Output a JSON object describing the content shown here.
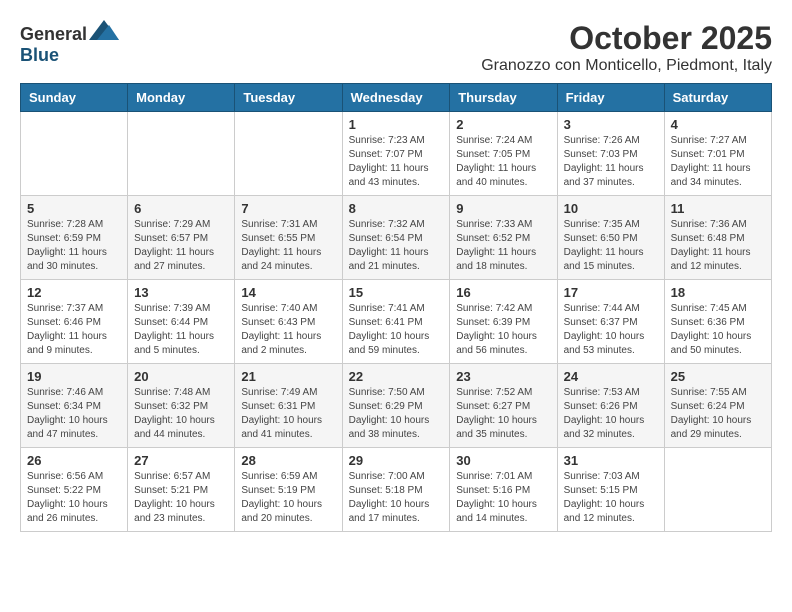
{
  "header": {
    "logo_general": "General",
    "logo_blue": "Blue",
    "month": "October 2025",
    "location": "Granozzo con Monticello, Piedmont, Italy"
  },
  "days_of_week": [
    "Sunday",
    "Monday",
    "Tuesday",
    "Wednesday",
    "Thursday",
    "Friday",
    "Saturday"
  ],
  "weeks": [
    [
      {
        "day": "",
        "sunrise": "",
        "sunset": "",
        "daylight": ""
      },
      {
        "day": "",
        "sunrise": "",
        "sunset": "",
        "daylight": ""
      },
      {
        "day": "",
        "sunrise": "",
        "sunset": "",
        "daylight": ""
      },
      {
        "day": "1",
        "sunrise": "Sunrise: 7:23 AM",
        "sunset": "Sunset: 7:07 PM",
        "daylight": "Daylight: 11 hours and 43 minutes."
      },
      {
        "day": "2",
        "sunrise": "Sunrise: 7:24 AM",
        "sunset": "Sunset: 7:05 PM",
        "daylight": "Daylight: 11 hours and 40 minutes."
      },
      {
        "day": "3",
        "sunrise": "Sunrise: 7:26 AM",
        "sunset": "Sunset: 7:03 PM",
        "daylight": "Daylight: 11 hours and 37 minutes."
      },
      {
        "day": "4",
        "sunrise": "Sunrise: 7:27 AM",
        "sunset": "Sunset: 7:01 PM",
        "daylight": "Daylight: 11 hours and 34 minutes."
      }
    ],
    [
      {
        "day": "5",
        "sunrise": "Sunrise: 7:28 AM",
        "sunset": "Sunset: 6:59 PM",
        "daylight": "Daylight: 11 hours and 30 minutes."
      },
      {
        "day": "6",
        "sunrise": "Sunrise: 7:29 AM",
        "sunset": "Sunset: 6:57 PM",
        "daylight": "Daylight: 11 hours and 27 minutes."
      },
      {
        "day": "7",
        "sunrise": "Sunrise: 7:31 AM",
        "sunset": "Sunset: 6:55 PM",
        "daylight": "Daylight: 11 hours and 24 minutes."
      },
      {
        "day": "8",
        "sunrise": "Sunrise: 7:32 AM",
        "sunset": "Sunset: 6:54 PM",
        "daylight": "Daylight: 11 hours and 21 minutes."
      },
      {
        "day": "9",
        "sunrise": "Sunrise: 7:33 AM",
        "sunset": "Sunset: 6:52 PM",
        "daylight": "Daylight: 11 hours and 18 minutes."
      },
      {
        "day": "10",
        "sunrise": "Sunrise: 7:35 AM",
        "sunset": "Sunset: 6:50 PM",
        "daylight": "Daylight: 11 hours and 15 minutes."
      },
      {
        "day": "11",
        "sunrise": "Sunrise: 7:36 AM",
        "sunset": "Sunset: 6:48 PM",
        "daylight": "Daylight: 11 hours and 12 minutes."
      }
    ],
    [
      {
        "day": "12",
        "sunrise": "Sunrise: 7:37 AM",
        "sunset": "Sunset: 6:46 PM",
        "daylight": "Daylight: 11 hours and 9 minutes."
      },
      {
        "day": "13",
        "sunrise": "Sunrise: 7:39 AM",
        "sunset": "Sunset: 6:44 PM",
        "daylight": "Daylight: 11 hours and 5 minutes."
      },
      {
        "day": "14",
        "sunrise": "Sunrise: 7:40 AM",
        "sunset": "Sunset: 6:43 PM",
        "daylight": "Daylight: 11 hours and 2 minutes."
      },
      {
        "day": "15",
        "sunrise": "Sunrise: 7:41 AM",
        "sunset": "Sunset: 6:41 PM",
        "daylight": "Daylight: 10 hours and 59 minutes."
      },
      {
        "day": "16",
        "sunrise": "Sunrise: 7:42 AM",
        "sunset": "Sunset: 6:39 PM",
        "daylight": "Daylight: 10 hours and 56 minutes."
      },
      {
        "day": "17",
        "sunrise": "Sunrise: 7:44 AM",
        "sunset": "Sunset: 6:37 PM",
        "daylight": "Daylight: 10 hours and 53 minutes."
      },
      {
        "day": "18",
        "sunrise": "Sunrise: 7:45 AM",
        "sunset": "Sunset: 6:36 PM",
        "daylight": "Daylight: 10 hours and 50 minutes."
      }
    ],
    [
      {
        "day": "19",
        "sunrise": "Sunrise: 7:46 AM",
        "sunset": "Sunset: 6:34 PM",
        "daylight": "Daylight: 10 hours and 47 minutes."
      },
      {
        "day": "20",
        "sunrise": "Sunrise: 7:48 AM",
        "sunset": "Sunset: 6:32 PM",
        "daylight": "Daylight: 10 hours and 44 minutes."
      },
      {
        "day": "21",
        "sunrise": "Sunrise: 7:49 AM",
        "sunset": "Sunset: 6:31 PM",
        "daylight": "Daylight: 10 hours and 41 minutes."
      },
      {
        "day": "22",
        "sunrise": "Sunrise: 7:50 AM",
        "sunset": "Sunset: 6:29 PM",
        "daylight": "Daylight: 10 hours and 38 minutes."
      },
      {
        "day": "23",
        "sunrise": "Sunrise: 7:52 AM",
        "sunset": "Sunset: 6:27 PM",
        "daylight": "Daylight: 10 hours and 35 minutes."
      },
      {
        "day": "24",
        "sunrise": "Sunrise: 7:53 AM",
        "sunset": "Sunset: 6:26 PM",
        "daylight": "Daylight: 10 hours and 32 minutes."
      },
      {
        "day": "25",
        "sunrise": "Sunrise: 7:55 AM",
        "sunset": "Sunset: 6:24 PM",
        "daylight": "Daylight: 10 hours and 29 minutes."
      }
    ],
    [
      {
        "day": "26",
        "sunrise": "Sunrise: 6:56 AM",
        "sunset": "Sunset: 5:22 PM",
        "daylight": "Daylight: 10 hours and 26 minutes."
      },
      {
        "day": "27",
        "sunrise": "Sunrise: 6:57 AM",
        "sunset": "Sunset: 5:21 PM",
        "daylight": "Daylight: 10 hours and 23 minutes."
      },
      {
        "day": "28",
        "sunrise": "Sunrise: 6:59 AM",
        "sunset": "Sunset: 5:19 PM",
        "daylight": "Daylight: 10 hours and 20 minutes."
      },
      {
        "day": "29",
        "sunrise": "Sunrise: 7:00 AM",
        "sunset": "Sunset: 5:18 PM",
        "daylight": "Daylight: 10 hours and 17 minutes."
      },
      {
        "day": "30",
        "sunrise": "Sunrise: 7:01 AM",
        "sunset": "Sunset: 5:16 PM",
        "daylight": "Daylight: 10 hours and 14 minutes."
      },
      {
        "day": "31",
        "sunrise": "Sunrise: 7:03 AM",
        "sunset": "Sunset: 5:15 PM",
        "daylight": "Daylight: 10 hours and 12 minutes."
      },
      {
        "day": "",
        "sunrise": "",
        "sunset": "",
        "daylight": ""
      }
    ]
  ]
}
